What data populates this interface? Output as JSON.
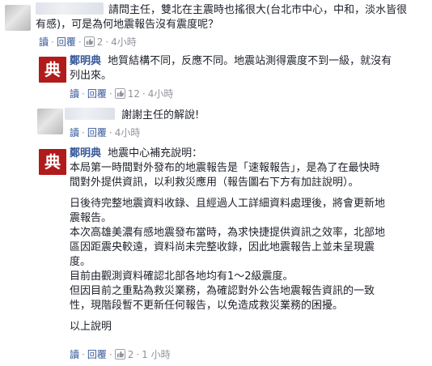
{
  "comments": [
    {
      "lines": [
        "請問主任，雙北在主震時也搖很大(台北市中心，中和，淡水皆很",
        "有感)，可是為何地震報告沒有震度呢？"
      ],
      "actions": {
        "reply": "讀",
        "reply2": "回覆",
        "likes": "2",
        "time": "4小時"
      }
    },
    {
      "name": "鄭明典",
      "lines": [
        "地質結構不同，反應不同。地震站測得震度不到一級，就沒有",
        "列出來。"
      ],
      "actions": {
        "reply": "讀",
        "reply2": "回覆",
        "likes": "12",
        "time": "4小時"
      }
    },
    {
      "lines": [
        "謝謝主任的解說!"
      ],
      "actions": {
        "reply": "讀",
        "reply2": "回覆",
        "time": "4小時"
      }
    },
    {
      "name": "鄭明典",
      "first": "地震中心補充說明：",
      "paragraphs": [
        [
          "本局第一時間對外發布的地震報告是「速報報告」，是為了在最快時",
          "間對外提供資訊，以利救災應用（報告圖右下方有加註說明）。"
        ],
        [
          "日後待完整地震資料收錄、且經過人工詳細資料處理後，將會更新地",
          "震報告。",
          "本次高雄美濃有感地震發布當時，為求快捷提供資訊之效率，北部地",
          "區因距震央較遠，資料尚未完整收錄，因此地震報告上並未呈現震",
          "度。",
          "目前由觀測資料確認北部各地均有1～2級震度。",
          "但因目前之重點為救災業務，為確認對外公告地震報告資訊的一致",
          "性，現階段暫不更新任何報告，以免造成救災業務的困擾。"
        ],
        [
          "以上說明"
        ]
      ],
      "actions": {
        "reply": "讀",
        "reply2": "回覆",
        "likes": "2",
        "time": "1 小時"
      }
    }
  ],
  "seal_char": "典",
  "colors": {
    "link": "#365899",
    "meta": "#90949c",
    "text": "#1d2129",
    "seal": "#b11b1b"
  }
}
